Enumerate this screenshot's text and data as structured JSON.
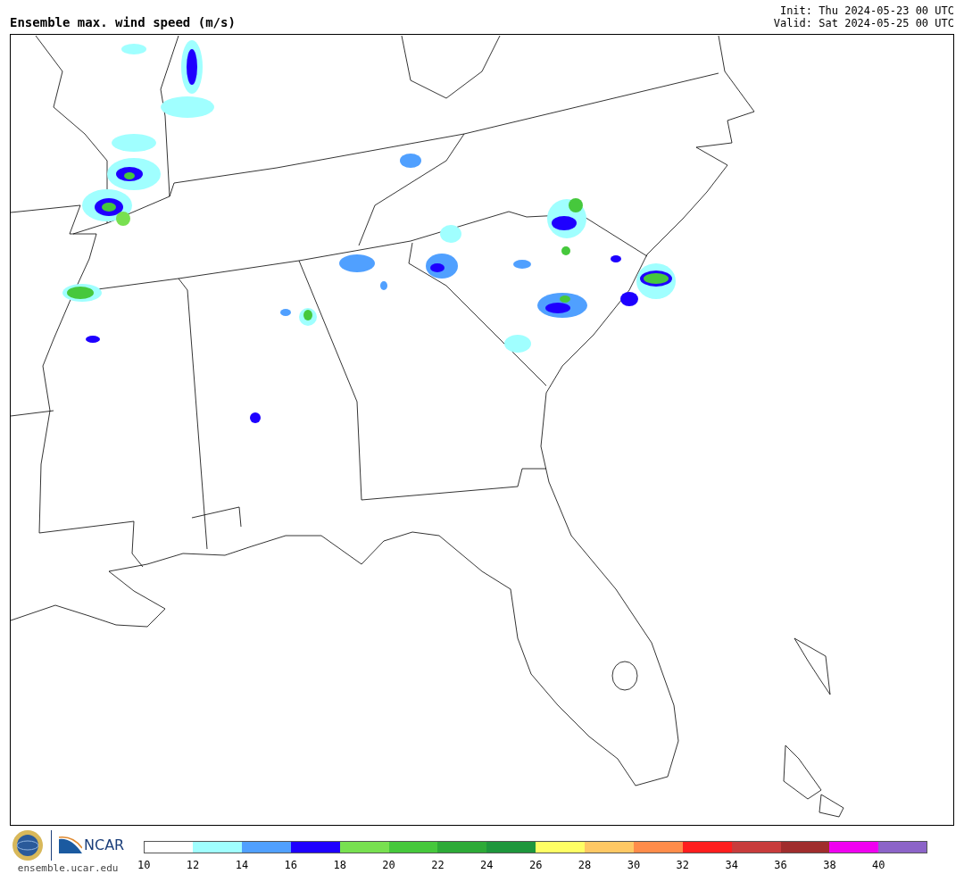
{
  "title": "Ensemble max. wind speed (m/s)",
  "init": "Init: Thu 2024-05-23 00 UTC",
  "valid": "Valid: Sat 2024-05-25 00 UTC",
  "footer": {
    "logo_text": "NCAR",
    "url": "ensemble.ucar.edu"
  },
  "colorbar": {
    "bins": [
      {
        "label": "10",
        "color": "#ffffff"
      },
      {
        "label": "12",
        "color": "#a0ffff"
      },
      {
        "label": "14",
        "color": "#50a0ff"
      },
      {
        "label": "16",
        "color": "#1e00ff"
      },
      {
        "label": "18",
        "color": "#78e050"
      },
      {
        "label": "20",
        "color": "#46c83c"
      },
      {
        "label": "22",
        "color": "#2daa37"
      },
      {
        "label": "24",
        "color": "#1e963c"
      },
      {
        "label": "26",
        "color": "#ffff64"
      },
      {
        "label": "28",
        "color": "#ffc864"
      },
      {
        "label": "30",
        "color": "#ff8c4a"
      },
      {
        "label": "32",
        "color": "#ff1e1e"
      },
      {
        "label": "34",
        "color": "#c83c3c"
      },
      {
        "label": "36",
        "color": "#a02d2d"
      },
      {
        "label": "38",
        "color": "#f000f0"
      },
      {
        "label": "40",
        "color": "#8c64c8"
      }
    ]
  }
}
